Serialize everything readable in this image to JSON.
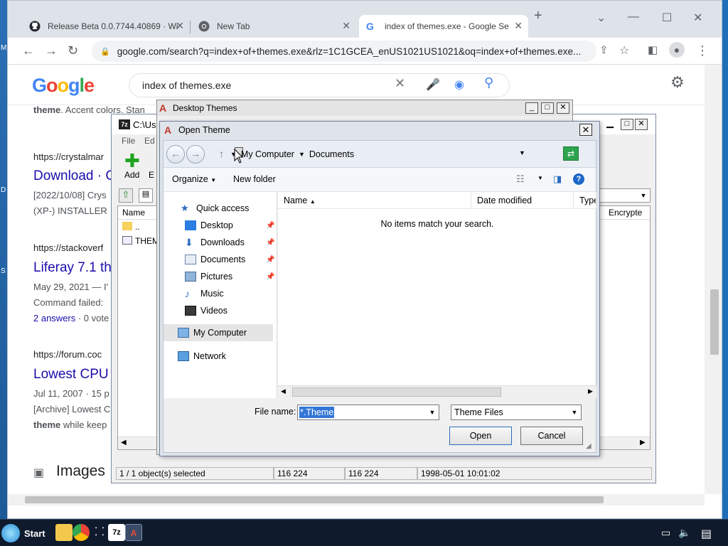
{
  "browser": {
    "tabs": [
      {
        "title": "Release Beta 0.0.7744.40869 · Wi",
        "icon": "github-icon"
      },
      {
        "title": "New Tab",
        "icon": "chrome-icon"
      },
      {
        "title": "index of themes.exe - Google Se",
        "icon": "google-icon",
        "active": true
      }
    ],
    "url": "google.com/search?q=index+of+themes.exe&rlz=1C1GCEA_enUS1021US1021&oq=index+of+themes.exe..."
  },
  "google": {
    "query": "index of themes.exe",
    "snippet_top_bold": "theme",
    "snippet_top": ". Accent colors. Stan",
    "results": [
      {
        "url": "https://crystalmar",
        "title": "Download · C",
        "line1": "[2022/10/08] Crys",
        "line2": "(XP-) INSTALLER"
      },
      {
        "url": "https://stackoverf",
        "title": "Liferay 7.1 th",
        "line1": "May 29, 2021 — I'",
        "line2": "Command failed:",
        "answers": "2 answers",
        "answers_rest": " · 0 vote"
      },
      {
        "url": "https://forum.coc",
        "title": "Lowest CPU",
        "line1": "Jul 11, 2007 · 15 p",
        "line2": "[Archive] Lowest C",
        "line3_bold": "theme",
        "line3": " while keep"
      }
    ],
    "images_label": "Images"
  },
  "sevenzip": {
    "title": "C:\\Us",
    "menu": [
      "File",
      "Ed"
    ],
    "add_label": "Add",
    "add_extra": "E",
    "columns": [
      "Name",
      "Encrypte"
    ],
    "rows": [
      "..",
      "THEM"
    ],
    "status": [
      "1 / 1 object(s) selected",
      "116 224",
      "116 224",
      "1998-05-01 10:01:02"
    ]
  },
  "desktop_themes": {
    "title": "Desktop Themes"
  },
  "open_dialog": {
    "title": "Open Theme",
    "breadcrumb": [
      "My Computer",
      "Documents"
    ],
    "organize": "Organize",
    "new_folder": "New folder",
    "nav": {
      "quick_access": "Quick access",
      "items": [
        "Desktop",
        "Downloads",
        "Documents",
        "Pictures",
        "Music",
        "Videos"
      ],
      "my_computer": "My Computer",
      "network": "Network"
    },
    "columns": [
      "Name",
      "Date modified",
      "Type"
    ],
    "empty_message": "No items match your search.",
    "file_name_label": "File name:",
    "file_name_value": "*.Theme",
    "filter_value": "Theme Files",
    "open_label": "Open",
    "cancel_label": "Cancel"
  },
  "taskbar": {
    "start_label": "Start"
  },
  "colors": {
    "google_blue": "#4285f4",
    "google_red": "#ea4335",
    "google_yellow": "#fbbc05",
    "google_green": "#34a853",
    "link": "#1a0dab",
    "selection": "#3377d6"
  }
}
